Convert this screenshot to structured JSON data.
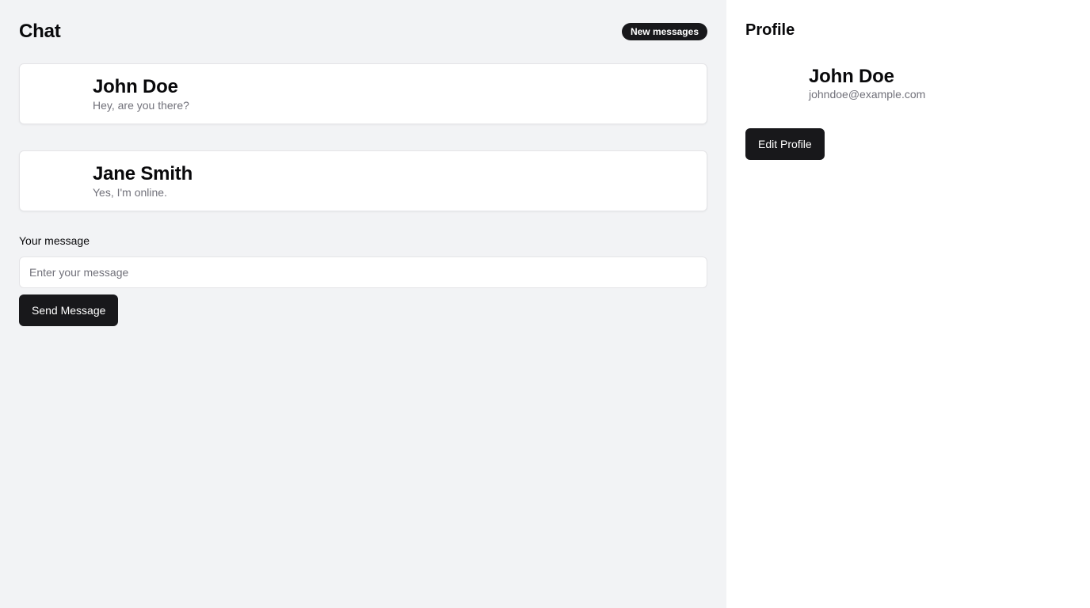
{
  "chat": {
    "title": "Chat",
    "badge": "New messages",
    "conversations": [
      {
        "name": "John Doe",
        "preview": "Hey, are you there?"
      },
      {
        "name": "Jane Smith",
        "preview": "Yes, I'm online."
      }
    ],
    "message_label": "Your message",
    "message_placeholder": "Enter your message",
    "message_value": "",
    "send_label": "Send Message"
  },
  "profile": {
    "title": "Profile",
    "name": "John Doe",
    "email": "johndoe@example.com",
    "edit_label": "Edit Profile"
  },
  "colors": {
    "primary": "#18181b",
    "chat_background": "#f2f3f5",
    "muted_text": "#71717a",
    "border": "#e4e4e7"
  }
}
